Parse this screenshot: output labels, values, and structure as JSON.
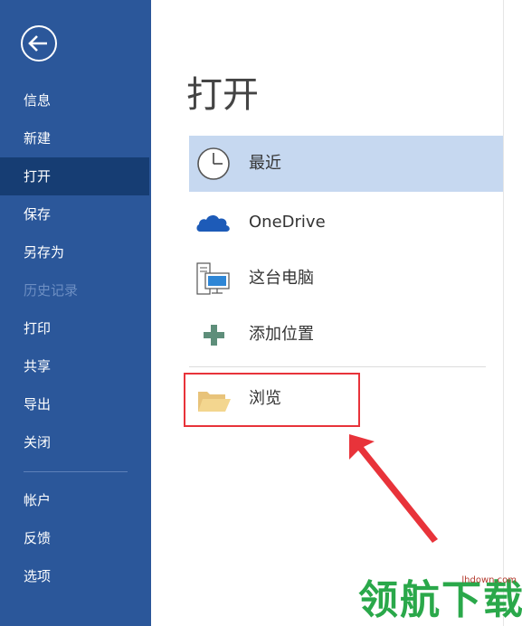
{
  "sidebar": {
    "back_icon": "back-arrow-icon",
    "items": [
      {
        "label": "信息",
        "state": "normal"
      },
      {
        "label": "新建",
        "state": "normal"
      },
      {
        "label": "打开",
        "state": "active"
      },
      {
        "label": "保存",
        "state": "normal"
      },
      {
        "label": "另存为",
        "state": "normal"
      },
      {
        "label": "历史记录",
        "state": "disabled"
      },
      {
        "label": "打印",
        "state": "normal"
      },
      {
        "label": "共享",
        "state": "normal"
      },
      {
        "label": "导出",
        "state": "normal"
      },
      {
        "label": "关闭",
        "state": "normal"
      }
    ],
    "bottom_items": [
      {
        "label": "帐户"
      },
      {
        "label": "反馈"
      },
      {
        "label": "选项"
      }
    ]
  },
  "main": {
    "title": "打开",
    "places": [
      {
        "label": "最近",
        "icon": "clock-icon",
        "selected": true
      },
      {
        "label": "OneDrive",
        "icon": "cloud-icon",
        "selected": false
      },
      {
        "label": "这台电脑",
        "icon": "computer-icon",
        "selected": false
      },
      {
        "label": "添加位置",
        "icon": "plus-icon",
        "selected": false
      },
      {
        "label": "浏览",
        "icon": "folder-icon",
        "selected": false
      }
    ]
  },
  "watermark": {
    "text": "领航下载",
    "url": "lhdown.com"
  },
  "colors": {
    "sidebar_bg": "#2b579a",
    "sidebar_active": "#163d73",
    "selected_place": "#c6d8f0",
    "annotation_red": "#e8333a",
    "watermark_green": "#2aa84a"
  }
}
